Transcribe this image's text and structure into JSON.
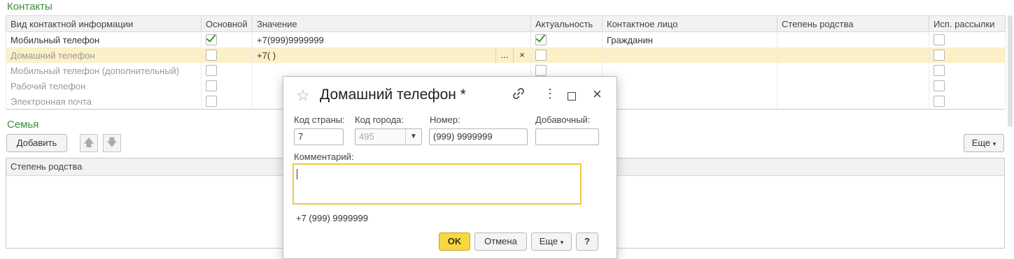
{
  "contacts": {
    "title": "Контакты",
    "columns": [
      "Вид контактной информации",
      "Основной",
      "Значение",
      "Актуальность",
      "Контактное лицо",
      "Степень родства",
      "Исп. рассылки"
    ],
    "rows": [
      {
        "type": "Мобильный телефон",
        "main": true,
        "value": "+7(999)9999999",
        "actual": true,
        "person": "Гражданин",
        "relation": "",
        "mailing": false,
        "state": "normal"
      },
      {
        "type": "Домашний телефон",
        "main": false,
        "value": "+7(  )",
        "actual": false,
        "person": "",
        "relation": "",
        "mailing": false,
        "state": "selected"
      },
      {
        "type": "Мобильный телефон (дополнительный)",
        "main": false,
        "value": "",
        "actual": false,
        "person": "",
        "relation": "",
        "mailing": false,
        "state": "muted"
      },
      {
        "type": "Рабочий телефон",
        "main": false,
        "value": "",
        "actual": false,
        "person": "",
        "relation": "",
        "mailing": false,
        "state": "muted"
      },
      {
        "type": "Электронная почта",
        "main": false,
        "value": "",
        "actual": false,
        "person": "",
        "relation": "",
        "mailing": false,
        "state": "muted"
      }
    ],
    "cell_buttons": {
      "select": "...",
      "clear": "×"
    }
  },
  "family": {
    "title": "Семья",
    "add_label": "Добавить",
    "more_label": "Еще",
    "column": "Степень родства",
    "up_icon": "arrow-up-icon",
    "down_icon": "arrow-down-icon"
  },
  "dialog": {
    "title": "Домашний телефон *",
    "country_code_label": "Код страны:",
    "country_code_value": "7",
    "city_code_label": "Код города:",
    "city_code_placeholder": "495",
    "number_label": "Номер:",
    "number_value": "(999) 9999999",
    "extension_label": "Добавочный:",
    "extension_value": "",
    "comment_label": "Комментарий:",
    "comment_value": "",
    "preview": "+7 (999) 9999999",
    "ok_label": "OK",
    "cancel_label": "Отмена",
    "more_label": "Еще",
    "help_label": "?",
    "icons": [
      "star-icon",
      "link-icon",
      "more-vert-icon",
      "maximize-icon",
      "close-icon"
    ]
  }
}
